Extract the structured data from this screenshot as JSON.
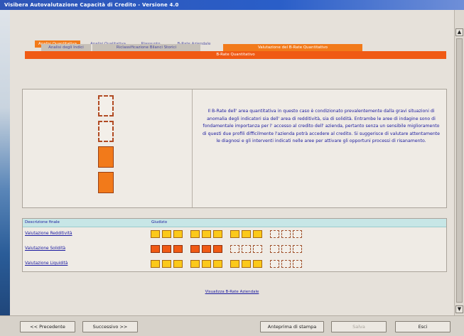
{
  "window": {
    "title": "Visibera Autovalutazione Capacità di Credito - Versione 4.0"
  },
  "tabs_row1": [
    {
      "label": "Analisi Quantitativa",
      "active": true
    },
    {
      "label": "Analisi Qualitativa",
      "active": false
    },
    {
      "label": "Riassunto",
      "active": false
    },
    {
      "label": "B-Rate Aziendale",
      "active": false
    }
  ],
  "tabs_row2": [
    {
      "label": "Analisi degli Indici",
      "active": false
    },
    {
      "label": "Riclassificazione Bilanci Storici",
      "active": false
    },
    {
      "label": "Valutazione del B-Rate Quantitativo",
      "active": true
    }
  ],
  "section_header": "B-Rate Quantitativo",
  "rating_stack": {
    "levels": 4,
    "filled": 2
  },
  "description": "Il B-Rate dell' area quantitativa in questo caso è condizionato prevalentemente dalla gravi situazioni di anomalia degli indicatori sia dell' area di redditività, sia di solidità. Entrambe le aree di indagine sono di fondamentale importanza per l' accesso al credito dell' azienda, pertanto senza un sensibile miglioramento di questi due profili difficilmente l'azienda potrà accedere al credito. Si suggerisce di valutare attentamente le diagnosi e gli interventi indicati nelle aree per attivare gli opportuni processi di risanamento.",
  "table": {
    "headers": [
      "Descrizione finale",
      "Giudizio"
    ],
    "rows": [
      {
        "label": "Valutazione Redditività",
        "cells": [
          "yellow",
          "yellow",
          "yellow",
          "yellow",
          "yellow",
          "yellow",
          "yellow",
          "yellow",
          "yellow",
          "empty",
          "empty",
          "empty"
        ]
      },
      {
        "label": "Valutazione Solidità",
        "cells": [
          "orange",
          "orange",
          "orange",
          "orange",
          "orange",
          "orange",
          "empty",
          "empty",
          "empty",
          "empty",
          "empty",
          "empty"
        ]
      },
      {
        "label": "Valutazione Liquidità",
        "cells": [
          "yellow",
          "yellow",
          "yellow",
          "yellow",
          "yellow",
          "yellow",
          "yellow",
          "yellow",
          "yellow",
          "empty",
          "empty",
          "empty"
        ]
      }
    ]
  },
  "center_link": "Visualizza B-Rate Aziendale",
  "footer": {
    "prev": "<< Precedente",
    "next": "Successivo >>",
    "print_preview": "Anteprima di stampa",
    "save": "Salva",
    "exit": "Esci"
  },
  "colors": {
    "orange": "#f27a1a",
    "red_orange": "#f05a14",
    "yellow": "#fbc91a",
    "title_blue": "#2a5ec8"
  }
}
